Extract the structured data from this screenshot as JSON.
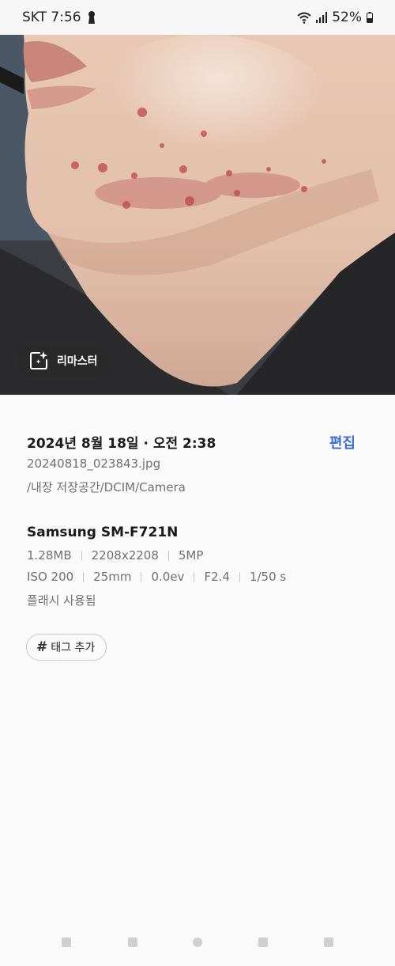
{
  "status_bar": {
    "carrier_time": "SKT 7:56",
    "battery": "52%"
  },
  "photo": {
    "remaster_label": "리마스터"
  },
  "details": {
    "datetime": "2024년 8월 18일 · 오전 2:38",
    "edit_label": "편집",
    "filename": "20240818_023843.jpg",
    "path": "/내장 저장공간/DCIM/Camera",
    "device": "Samsung SM-F721N",
    "file_specs": [
      "1.28MB",
      "2208x2208",
      "5MP"
    ],
    "camera_specs": [
      "ISO 200",
      "25mm",
      "0.0ev",
      "F2.4",
      "1/50 s"
    ],
    "flash": "플래시 사용됨",
    "tag_label": "태그 추가",
    "tag_symbol": "#"
  },
  "icons": {
    "status": [
      "keyhole-icon",
      "wifi-icon",
      "signal-icon",
      "battery-icon"
    ],
    "remaster": "sparkle-frame-icon",
    "nav": [
      "nav-square-icon",
      "nav-square-icon",
      "nav-home-icon",
      "nav-square-icon",
      "nav-square-icon"
    ]
  }
}
